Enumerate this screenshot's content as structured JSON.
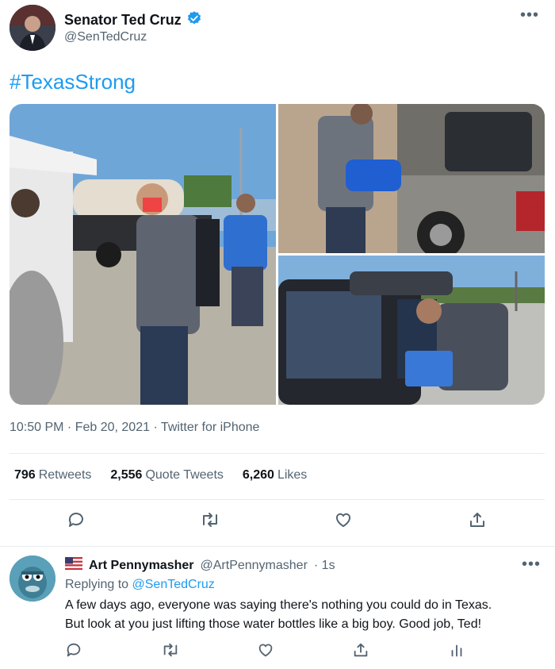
{
  "tweet": {
    "author_name": "Senator Ted Cruz",
    "author_handle": "@SenTedCruz",
    "text": "#TexasStrong",
    "timestamp": "10:50 PM · Feb 20, 2021 · Twitter for iPhone",
    "stats": {
      "retweets_count": "796",
      "retweets_label": "Retweets",
      "quotes_count": "2,556",
      "quotes_label": "Quote Tweets",
      "likes_count": "6,260",
      "likes_label": "Likes"
    },
    "more_icon": "more-horizontal-icon",
    "verified_icon": "verified-badge-icon"
  },
  "reply": {
    "author_name": "Art Pennymasher",
    "author_handle": "@ArtPennymasher",
    "time": "· 1s",
    "replying_prefix": "Replying to",
    "replying_handle": "@SenTedCruz",
    "text_line1": "A few days ago, everyone was saying there's nothing you could do in Texas.",
    "text_line2": "But look at you just lifting those water bottles like a big boy. Good job, Ted!"
  },
  "colors": {
    "accent": "#1d9bf0",
    "text_primary": "#0f1419",
    "text_secondary": "#536471",
    "divider": "#e6ecf0"
  }
}
